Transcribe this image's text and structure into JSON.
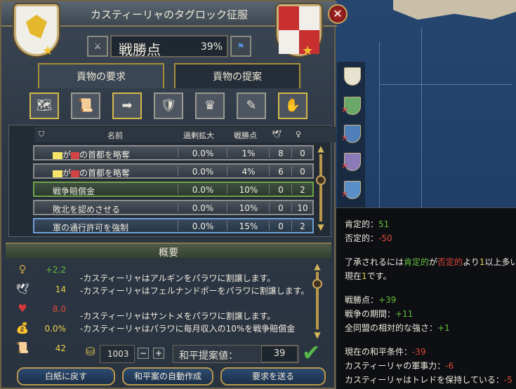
{
  "window": {
    "title": "カスティーリャのタグロック征服"
  },
  "warscore": {
    "label": "戦勝点",
    "value": "39%"
  },
  "tabs": {
    "demand": "貢物の要求",
    "offer": "貢物の提案"
  },
  "table": {
    "headers": {
      "name": "名前",
      "overextension": "過剰拡大",
      "warscore": "戦勝点"
    },
    "rows": [
      {
        "title": "の首都を略奪",
        "overext": "0.0%",
        "ws": "1%",
        "diplo": "8",
        "base": "0",
        "style": "gray"
      },
      {
        "title": "の首都を略奪",
        "overext": "0.0%",
        "ws": "4%",
        "diplo": "6",
        "base": "0",
        "style": "gray"
      },
      {
        "title": "戦争賠償金",
        "overext": "0.0%",
        "ws": "10%",
        "diplo": "0",
        "base": "2",
        "style": "green"
      },
      {
        "title": "敗北を認めさせる",
        "overext": "0.0%",
        "ws": "10%",
        "diplo": "0",
        "base": "10",
        "style": "gray"
      },
      {
        "title": "軍の通行許可を強制",
        "overext": "0.0%",
        "ws": "15%",
        "diplo": "0",
        "base": "2",
        "style": "blue"
      }
    ],
    "row_connector": "が"
  },
  "summary": {
    "title": "概要",
    "stats": [
      {
        "icon": "prestige-icon",
        "value": "+2.2",
        "color": "#66c03c"
      },
      {
        "icon": "dove-icon",
        "value": "14",
        "color": "#e7d24c"
      },
      {
        "icon": "heart-icon",
        "value": "8.0",
        "color": "#e04a3a"
      },
      {
        "icon": "money-bag-icon",
        "value": "0.0%",
        "color": "#e7d24c"
      },
      {
        "icon": "scroll-icon",
        "value": "42",
        "color": "#e7d24c"
      }
    ],
    "description": [
      "-カスティーリャはアルギンをパラワに割譲します。",
      "-カスティーリャはフェルナンドポーをパラワに割譲します。",
      "-カスティーリャはサントメをパラワに割譲します。",
      "-カスティーリャはパラワに毎月収入の10%を戦争賠償金"
    ]
  },
  "gold": {
    "value": "1003",
    "minus": "−",
    "plus": "+"
  },
  "peace": {
    "label": "和平提案値：",
    "value": "39"
  },
  "buttons": {
    "reset": "白紙に戻す",
    "auto": "和平案の自動作成",
    "send": "要求を送る"
  },
  "tooltip": {
    "positive_label": "肯定的：",
    "positive": "51",
    "negative_label": "否定的：",
    "negative": "-50",
    "line1_a": "了承されるには",
    "line1_b": "肯定的",
    "line1_c": "が",
    "line1_d": "否定的",
    "line1_e": "より",
    "line1_f": "1",
    "line1_g": "以上多い",
    "line2_a": "現在",
    "line2_b": "1",
    "line2_c": "です。",
    "ws_label": "戦勝点：",
    "ws": "+39",
    "duration_label": "戦争の期間：",
    "duration": "+11",
    "alliance_label": "全同盟の相対的な強さ：",
    "alliance": "+1",
    "current_label": "現在の和平条件：",
    "current": "-39",
    "military_label": "カスティーリャの軍事力：",
    "military": "-6",
    "holds_label": "カスティーリャはトレドを保持している：",
    "holds": "-5"
  }
}
